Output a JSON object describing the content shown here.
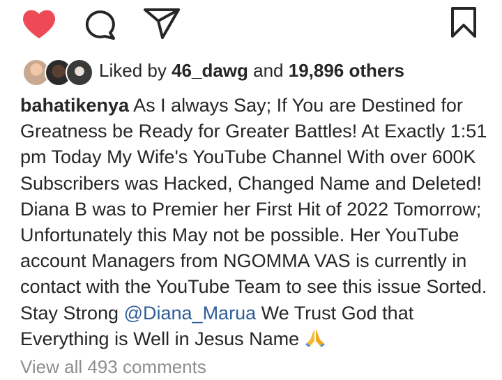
{
  "actions": {
    "like": {
      "icon": "heart-filled-icon",
      "active": true,
      "color": "#ed4956"
    },
    "comment": {
      "icon": "comment-icon"
    },
    "share": {
      "icon": "send-icon"
    },
    "save": {
      "icon": "bookmark-icon"
    }
  },
  "likes": {
    "prefix": "Liked by ",
    "user": "46_dawg",
    "joiner": " and ",
    "others": "19,896 others",
    "avatars": [
      "avatar",
      "avatar",
      "avatar"
    ]
  },
  "caption": {
    "username": "bahatikenya",
    "text_before_mention": " As I always Say; If You are Destined for Greatness be Ready for Greater Battles! At Exactly 1:51 pm Today My Wife's YouTube Channel With over 600K Subscribers was Hacked, Changed Name and Deleted! Diana B was to Premier her First Hit of 2022 Tomorrow; Unfortunately this May not be possible. Her YouTube account Managers from NGOMMA VAS is currently in contact with the YouTube Team to see this issue Sorted. Stay Strong ",
    "mention": "@Diana_Marua",
    "text_after_mention": " We Trust God that Everything is Well in Jesus Name ",
    "emoji": "folded-hands-icon"
  },
  "comments": {
    "view_all": "View all 493 comments"
  },
  "colors": {
    "text": "#262626",
    "muted": "#8e8e8e",
    "link": "#2f5d98",
    "like": "#ed4956"
  }
}
